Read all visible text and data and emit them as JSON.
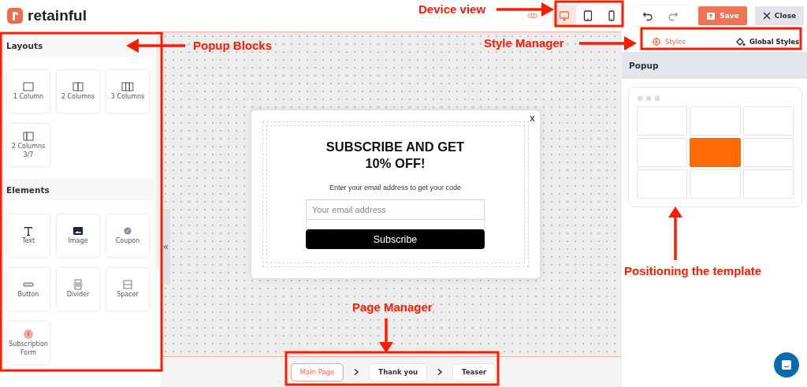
{
  "header": {
    "logo": "retainful",
    "devices": [
      {
        "kind": "desktop",
        "selected": true
      },
      {
        "kind": "tablet",
        "selected": false
      },
      {
        "kind": "mobile",
        "selected": false
      }
    ],
    "save": "Save",
    "close": "Close"
  },
  "sidebar": {
    "sections": [
      {
        "title": "Layouts",
        "blocks": [
          {
            "kind": "col1",
            "label": "1 Column"
          },
          {
            "kind": "col2",
            "label": "2 Columns"
          },
          {
            "kind": "col3",
            "label": "3 Columns"
          },
          {
            "kind": "col37",
            "label": "2 Columns 3/7"
          }
        ]
      },
      {
        "title": "Elements",
        "blocks": [
          {
            "kind": "text",
            "label": "Text"
          },
          {
            "kind": "image",
            "label": "Image"
          },
          {
            "kind": "coupon",
            "label": "Coupon"
          },
          {
            "kind": "button",
            "label": "Button"
          },
          {
            "kind": "divider",
            "label": "Divider"
          },
          {
            "kind": "spacer",
            "label": "Spacer"
          },
          {
            "kind": "form",
            "label": "Subscription Form"
          }
        ]
      }
    ],
    "collapse": "«"
  },
  "popup": {
    "close": "x",
    "headline": "SUBSCRIBE AND GET 10% OFF!",
    "subtext": "Enter your email address to get your code",
    "email_placeholder": "Your email address",
    "button": "Subscribe"
  },
  "pages": [
    {
      "label": "Main Page",
      "selected": true
    },
    {
      "label": "Thank you",
      "selected": false
    },
    {
      "label": "Teaser",
      "selected": false
    }
  ],
  "style_tabs": [
    {
      "kind": "styles",
      "label": "Styles",
      "selected": true
    },
    {
      "kind": "global",
      "label": "Global Styles",
      "selected": false
    }
  ],
  "panel": {
    "title": "Popup",
    "positions": [
      {
        "selected": false
      },
      {
        "selected": false
      },
      {
        "selected": false
      },
      {
        "selected": false
      },
      {
        "selected": true
      },
      {
        "selected": false
      },
      {
        "selected": false
      },
      {
        "selected": false
      },
      {
        "selected": false
      }
    ]
  },
  "annotations": [
    {
      "label": "Device view"
    },
    {
      "label": "Popup Blocks"
    },
    {
      "label": "Style Manager"
    },
    {
      "label": "Positioning the template"
    },
    {
      "label": "Page Manager"
    }
  ]
}
